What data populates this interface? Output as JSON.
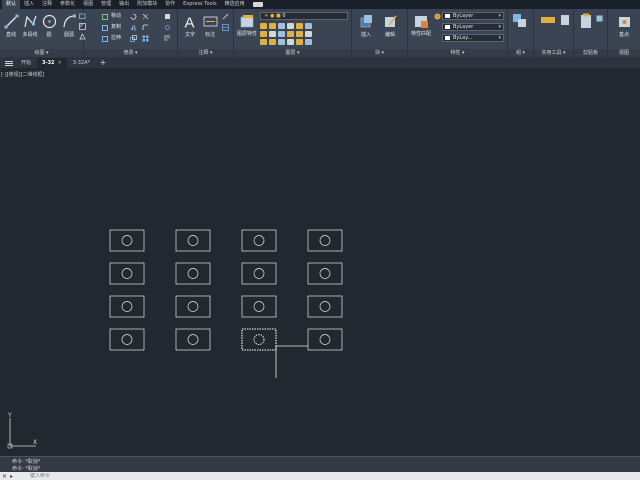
{
  "menu": {
    "tabs": [
      "默认",
      "插入",
      "注释",
      "参数化",
      "视图",
      "管理",
      "输出",
      "附加模块",
      "协作",
      "Express Tools",
      "精选应用"
    ],
    "active_index": 0
  },
  "ribbon": {
    "draw_panel": {
      "title": "绘图 ▾",
      "line": "直线",
      "polyline": "多段线",
      "circle": "圆",
      "arc": "圆弧"
    },
    "modify_panel": {
      "title": "修改 ▾",
      "move": "移动",
      "copy": "复制",
      "stretch": "拉伸"
    },
    "annotation_panel": {
      "title": "注释 ▾",
      "text": "文字",
      "dimension": "标注"
    },
    "layers_panel": {
      "title": "图层 ▾",
      "layer_props": "图层特性",
      "layer_value": "0"
    },
    "block_panel": {
      "title": "块 ▾",
      "insert": "插入",
      "edit": "编辑"
    },
    "properties_panel": {
      "title": "特性 ▾",
      "match": "特性匹配",
      "color": "ByLayer",
      "linetype": "ByLayer",
      "lineweight": "ByLay..."
    },
    "groups_panel": {
      "title": "组 ▾"
    },
    "utilities_panel": {
      "title": "实用工具 ▾"
    },
    "clipboard_panel": {
      "title": "剪贴板"
    },
    "view_panel": {
      "title": "视图",
      "base": "基点"
    }
  },
  "file_tabs": [
    {
      "label": "开始",
      "active": false
    },
    {
      "label": "3-32",
      "active": true
    },
    {
      "label": "3-32A*",
      "active": false
    }
  ],
  "viewport": {
    "label": "[-][俯视][二维线框]"
  },
  "drawing": {
    "rows": 4,
    "cols": 4,
    "selected": {
      "row": 3,
      "col": 2
    },
    "colors": {
      "background": "#212830",
      "rect": "#e6e6e6",
      "circle": "#e6e6e6",
      "selected_dash": "#ffffff",
      "crosshair": "#ffffff",
      "ucs": "#d8d8d8"
    }
  },
  "ucs": {
    "x_label": "X",
    "y_label": "Y"
  },
  "command": {
    "history": [
      "命令: *取消*",
      "命令: *取消*"
    ],
    "placeholder": "键入命令"
  }
}
